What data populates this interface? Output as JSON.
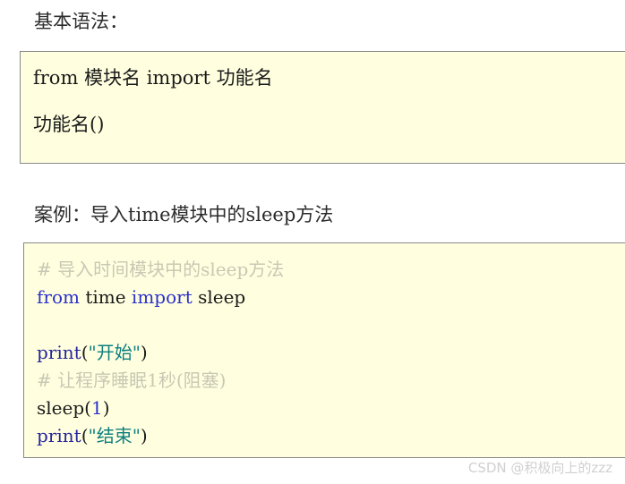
{
  "page": {
    "background_color": "#ffffff",
    "code_box_background": "#ffffe0",
    "code_box_border": "#888888"
  },
  "headings": {
    "basic_syntax": "基本语法：",
    "example": "案例：导入time模块中的sleep方法"
  },
  "syntax_box": {
    "lines": [
      {
        "text": "from 模块名 import 功能名",
        "kind": "plain"
      },
      {
        "text": "",
        "kind": "blank"
      },
      {
        "text": "功能名()",
        "kind": "plain"
      }
    ]
  },
  "example_box": {
    "lines": [
      {
        "tokens": [
          {
            "text": "# 导入时间模块中的sleep方法",
            "type": "comment"
          }
        ]
      },
      {
        "tokens": [
          {
            "text": "from",
            "type": "keyword"
          },
          {
            "text": " ",
            "type": "plain"
          },
          {
            "text": "time",
            "type": "plain"
          },
          {
            "text": " ",
            "type": "plain"
          },
          {
            "text": "import",
            "type": "keyword"
          },
          {
            "text": " ",
            "type": "plain"
          },
          {
            "text": "sleep",
            "type": "plain"
          }
        ]
      },
      {
        "tokens": []
      },
      {
        "tokens": [
          {
            "text": "print",
            "type": "function"
          },
          {
            "text": "(",
            "type": "plain"
          },
          {
            "text": "\"开始\"",
            "type": "string"
          },
          {
            "text": ")",
            "type": "plain"
          }
        ]
      },
      {
        "tokens": [
          {
            "text": "# 让程序睡眠1秒(阻塞)",
            "type": "comment"
          }
        ]
      },
      {
        "tokens": [
          {
            "text": "sleep",
            "type": "plain"
          },
          {
            "text": "(",
            "type": "plain"
          },
          {
            "text": "1",
            "type": "number"
          },
          {
            "text": ")",
            "type": "plain"
          }
        ]
      },
      {
        "tokens": [
          {
            "text": "print",
            "type": "function"
          },
          {
            "text": "(",
            "type": "plain"
          },
          {
            "text": "\"结束\"",
            "type": "string"
          },
          {
            "text": ")",
            "type": "plain"
          }
        ]
      }
    ]
  },
  "watermark": {
    "text": "CSDN @积极向上的zzz",
    "color": "#d0d0d0"
  },
  "syntax_colors": {
    "keyword": "#2b31c9",
    "function": "#26279b",
    "string": "#0f7f7f",
    "number": "#2b31c9",
    "comment": "#c8c8b4",
    "plain": "#1a1a1a"
  }
}
